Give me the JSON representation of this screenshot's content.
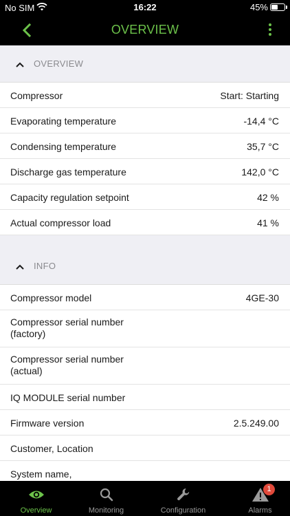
{
  "status_bar": {
    "carrier": "No SIM",
    "time": "16:22",
    "battery": "45%"
  },
  "nav": {
    "title": "OVERVIEW"
  },
  "sections": {
    "overview": {
      "title": "OVERVIEW",
      "rows": [
        {
          "label": "Compressor",
          "value": "Start: Starting"
        },
        {
          "label": "Evaporating temperature",
          "value": "-14,4 °C"
        },
        {
          "label": "Condensing temperature",
          "value": "35,7 °C"
        },
        {
          "label": "Discharge gas temperature",
          "value": "142,0 °C"
        },
        {
          "label": "Capacity regulation setpoint",
          "value": "42 %"
        },
        {
          "label": "Actual compressor load",
          "value": "41 %"
        }
      ]
    },
    "info": {
      "title": "INFO",
      "rows": [
        {
          "label": "Compressor model",
          "value": "4GE-30"
        },
        {
          "label": "Compressor serial number (factory)",
          "value": ""
        },
        {
          "label": "Compressor serial number (actual)",
          "value": ""
        },
        {
          "label": "IQ MODULE serial number",
          "value": ""
        },
        {
          "label": "Firmware version",
          "value": "2.5.249.00"
        },
        {
          "label": "Customer, Location",
          "value": ""
        },
        {
          "label": "System name,",
          "value": ""
        }
      ]
    }
  },
  "tab_bar": {
    "tabs": [
      {
        "label": "Overview",
        "icon": "eye-icon",
        "active": true
      },
      {
        "label": "Monitoring",
        "icon": "search-icon",
        "active": false
      },
      {
        "label": "Configuration",
        "icon": "wrench-icon",
        "active": false
      },
      {
        "label": "Alarms",
        "icon": "warning-icon",
        "active": false,
        "badge": "1"
      }
    ]
  },
  "colors": {
    "accent": "#6cc24a",
    "bar": "#000000",
    "badge": "#e0493a",
    "section_bg": "#efeff4"
  }
}
